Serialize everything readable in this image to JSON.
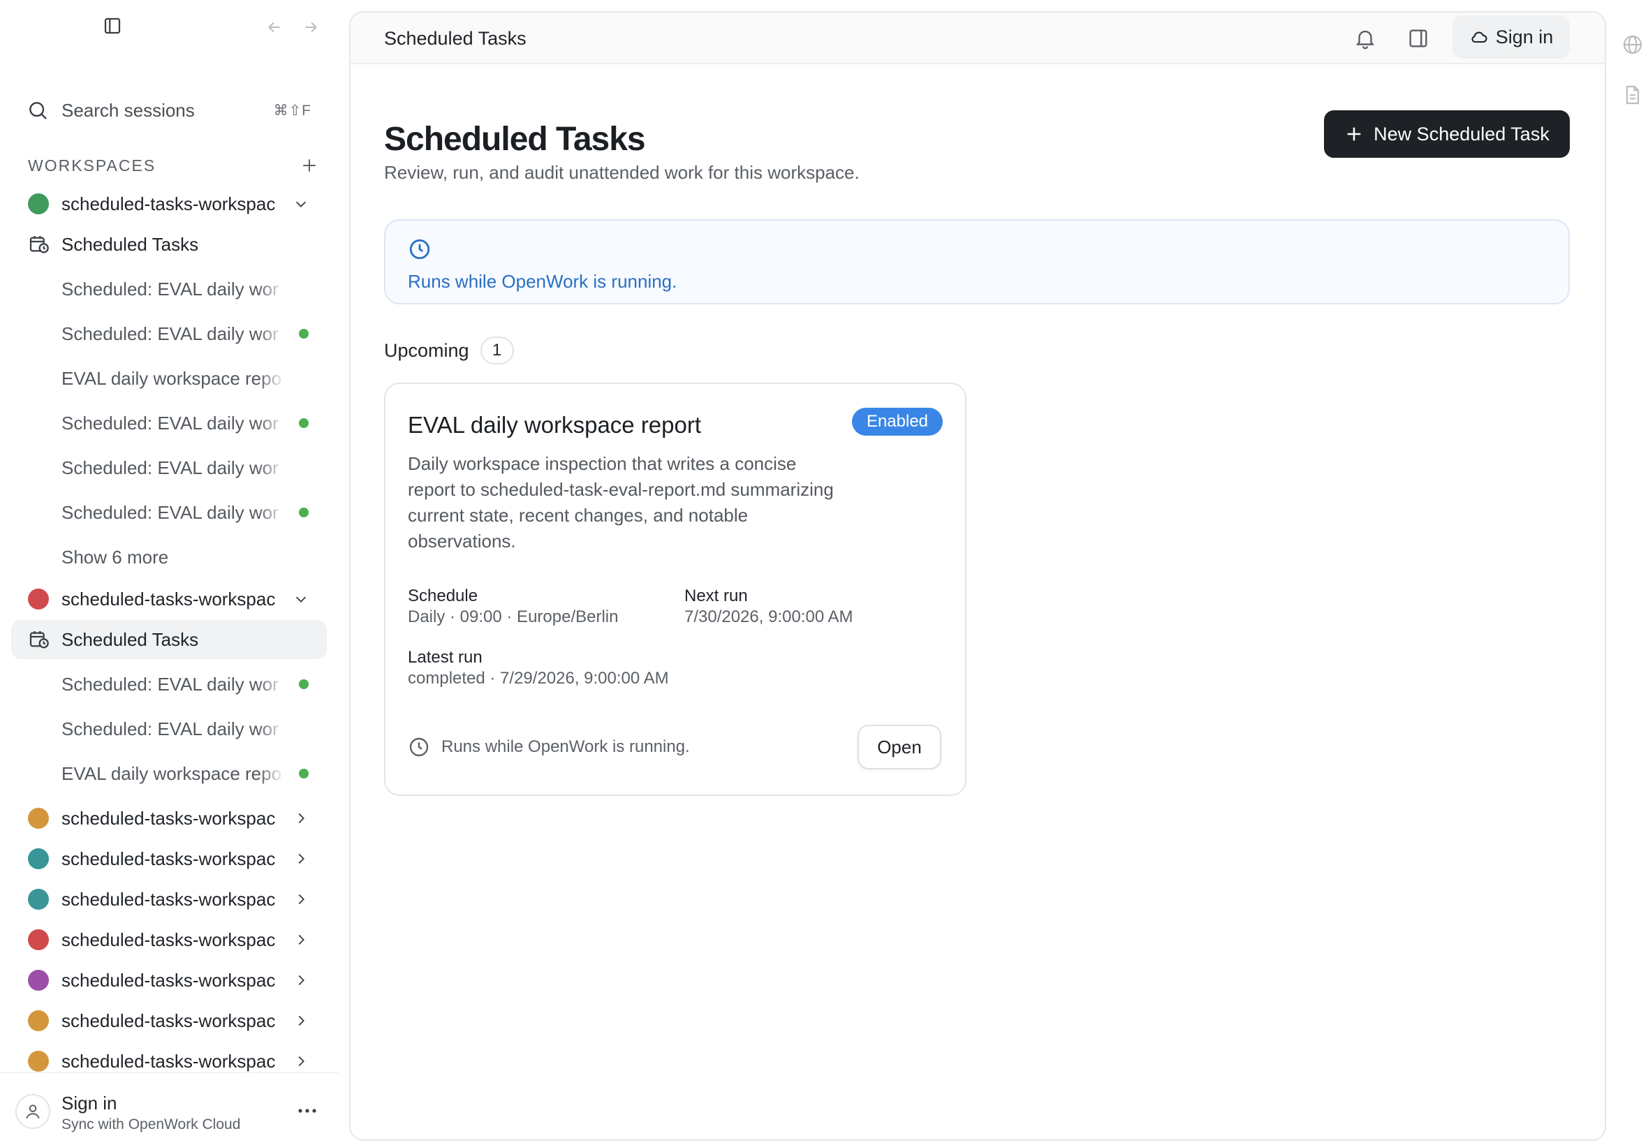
{
  "sidebar": {
    "search": {
      "label": "Search sessions",
      "shortcut": "⌘⇧F"
    },
    "workspaces_title": "WORKSPACES",
    "workspace_1": {
      "name": "scheduled-tasks-workspac",
      "color": "#3f9a5c",
      "section": "Scheduled Tasks",
      "items": [
        {
          "label": "Scheduled: EVAL daily wor",
          "active": false
        },
        {
          "label": "Scheduled: EVAL daily wor",
          "active": true
        },
        {
          "label": "EVAL daily workspace repo",
          "active": false
        },
        {
          "label": "Scheduled: EVAL daily wor",
          "active": true
        },
        {
          "label": "Scheduled: EVAL daily wor",
          "active": false
        },
        {
          "label": "Scheduled: EVAL daily wor",
          "active": true
        }
      ],
      "show_more": "Show 6 more"
    },
    "workspace_2": {
      "name": "scheduled-tasks-workspac",
      "color": "#d04a4d",
      "section": "Scheduled Tasks",
      "items": [
        {
          "label": "Scheduled: EVAL daily wor",
          "active": true
        },
        {
          "label": "Scheduled: EVAL daily wor",
          "active": false
        },
        {
          "label": "EVAL daily workspace repo",
          "active": true
        }
      ]
    },
    "collapsed_workspaces": [
      {
        "name": "scheduled-tasks-workspac",
        "color": "#d4963c"
      },
      {
        "name": "scheduled-tasks-workspac",
        "color": "#3a9597"
      },
      {
        "name": "scheduled-tasks-workspac",
        "color": "#3a9597"
      },
      {
        "name": "scheduled-tasks-workspac",
        "color": "#d04a4d"
      },
      {
        "name": "scheduled-tasks-workspac",
        "color": "#9c4fa6"
      },
      {
        "name": "scheduled-tasks-workspac",
        "color": "#d4963c"
      },
      {
        "name": "scheduled-tasks-workspac",
        "color": "#d4963c"
      }
    ],
    "footer": {
      "name": "Sign in",
      "subtitle": "Sync with OpenWork Cloud"
    }
  },
  "topbar": {
    "title": "Scheduled Tasks",
    "signin_label": "Sign in"
  },
  "page": {
    "title": "Scheduled Tasks",
    "subtitle": "Review, run, and audit unattended work for this workspace.",
    "new_button": "New Scheduled Task",
    "info_text": "Runs while OpenWork is running.",
    "upcoming_label": "Upcoming",
    "upcoming_count": "1"
  },
  "card": {
    "title": "EVAL daily workspace report",
    "badge": "Enabled",
    "description": "Daily workspace inspection that writes a concise report to scheduled-task-eval-report.md summarizing current state, recent changes, and notable observations.",
    "schedule_label": "Schedule",
    "schedule_value": "Daily · 09:00 · Europe/Berlin",
    "next_run_label": "Next run",
    "next_run_value": "7/30/2026, 9:00:00 AM",
    "latest_run_label": "Latest run",
    "latest_run_value": "completed · 7/29/2026, 9:00:00 AM",
    "footer_text": "Runs while OpenWork is running.",
    "open_label": "Open"
  },
  "icons": {
    "sidebar_toggle": "sidebar-toggle-icon",
    "back": "arrow-left-icon",
    "forward": "arrow-right-icon",
    "search": "search-icon",
    "add": "plus-icon",
    "calendar": "calendar-clock-icon",
    "chevron_down": "chevron-down-icon",
    "chevron_right": "chevron-right-icon",
    "bell": "bell-icon",
    "panel": "panel-right-icon",
    "cloud": "cloud-icon",
    "clock": "clock-icon",
    "user": "user-icon",
    "more": "more-horizontal-icon",
    "globe": "globe-icon",
    "document": "document-icon"
  },
  "colors": {
    "accent_blue": "#3a86e6",
    "status_green": "#4caf50",
    "dark_button": "#1e2125"
  }
}
